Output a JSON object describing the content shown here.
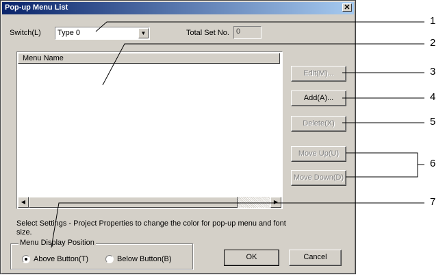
{
  "window": {
    "title": "Pop-up Menu List",
    "close_glyph": "✕"
  },
  "switch": {
    "label": "Switch(L)",
    "value": "Type 0",
    "arrow": "▼"
  },
  "total_set": {
    "label": "Total Set No.",
    "value": "0"
  },
  "list": {
    "column_header": "Menu Name",
    "left_arrow": "◀",
    "right_arrow": "▶"
  },
  "buttons": {
    "edit": "Edit(M)...",
    "add": "Add(A)...",
    "delete": "Delete(X)",
    "move_up": "Move Up(U)",
    "move_down": "Move Down(D)",
    "ok": "OK",
    "cancel": "Cancel"
  },
  "note": "Select Settings - Project Properties to change the color for pop-up menu and font size.",
  "display_position": {
    "label": "Menu Display Position",
    "above": "Above Button(T)",
    "below": "Below Button(B)",
    "selected": "above"
  },
  "callouts": [
    "1",
    "2",
    "3",
    "4",
    "5",
    "6",
    "7"
  ]
}
